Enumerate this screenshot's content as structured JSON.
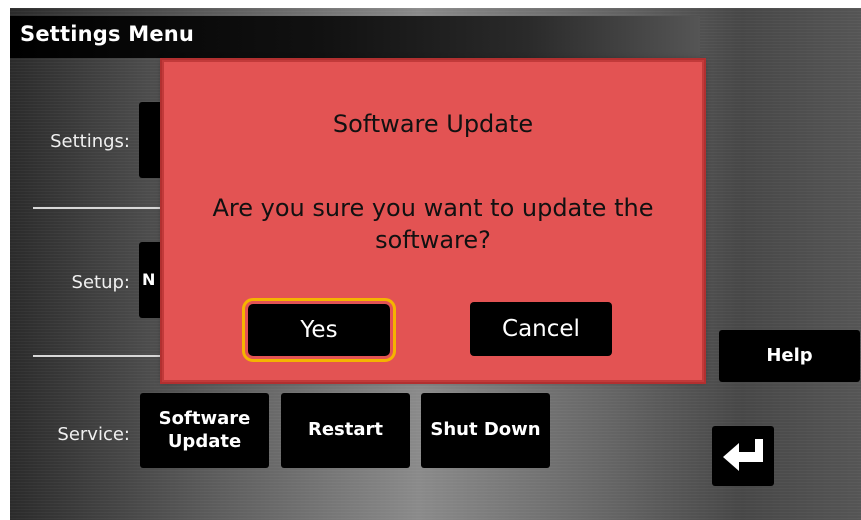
{
  "header": {
    "title": "Settings Menu"
  },
  "rows": {
    "settings": {
      "label": "Settings:"
    },
    "setup": {
      "label": "Setup:",
      "partial_button_text": "N"
    },
    "service": {
      "label": "Service:"
    }
  },
  "service_buttons": {
    "software_update": "Software\nUpdate",
    "restart": "Restart",
    "shut_down": "Shut Down"
  },
  "side_buttons": {
    "help": "Help",
    "back_icon": "return-arrow-icon"
  },
  "dialog": {
    "title": "Software Update",
    "message": "Are you sure you want to update the software?",
    "yes_label": "Yes",
    "cancel_label": "Cancel"
  },
  "colors": {
    "dialog_bg": "#e35353",
    "focus_ring": "#f5b400",
    "button_bg": "#000000",
    "title_bar": "#000000"
  }
}
